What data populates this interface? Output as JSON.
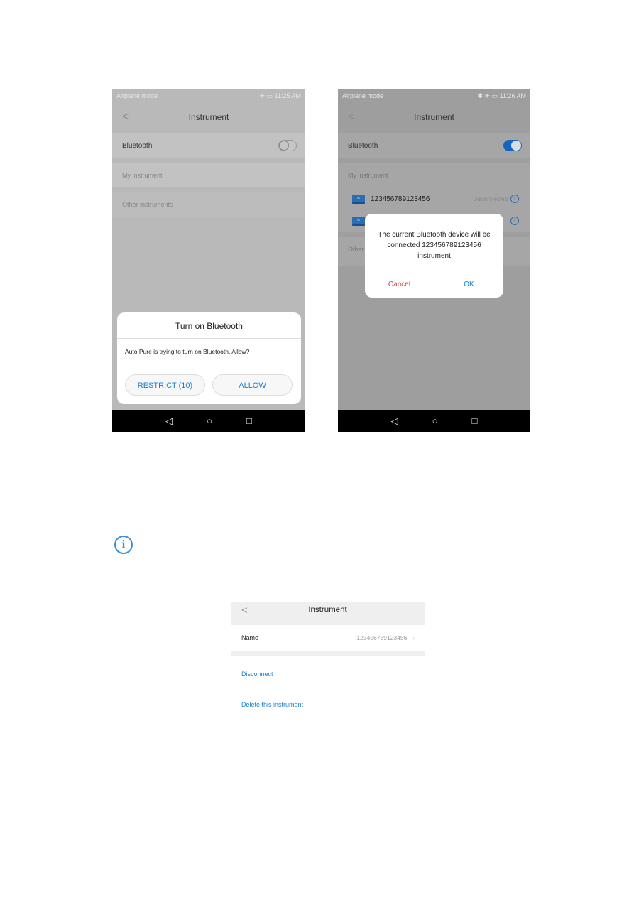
{
  "screen1": {
    "status_left": "Airplane mode",
    "status_right": "11:25 AM",
    "title": "Instrument",
    "bluetooth_label": "Bluetooth",
    "bluetooth_on": false,
    "my_instrument": "My instrument",
    "other_instruments": "Other instruments",
    "dialog": {
      "title": "Turn on Bluetooth",
      "message": "Auto Pure is trying to turn on Bluetooth. Allow?",
      "restrict": "RESTRICT (10)",
      "allow": "ALLOW"
    }
  },
  "screen2": {
    "status_left": "Airplane mode",
    "status_right": "11:26 AM",
    "title": "Instrument",
    "bluetooth_label": "Bluetooth",
    "bluetooth_on": true,
    "my_instrument": "My instrument",
    "device_name": "123456789123456",
    "device_status": "Disconnected",
    "other_partial": "Other",
    "dialog": {
      "message": "The current Bluetooth device will be connected 123456789123456 instrument",
      "cancel": "Cancel",
      "ok": "OK"
    }
  },
  "screen3": {
    "title": "Instrument",
    "name_label": "Name",
    "name_value": "123456789123456",
    "disconnect": "Disconnect",
    "delete": "Delete this instrument"
  },
  "colors": {
    "accent": "#1a7fd6",
    "cancel": "#e04040"
  }
}
